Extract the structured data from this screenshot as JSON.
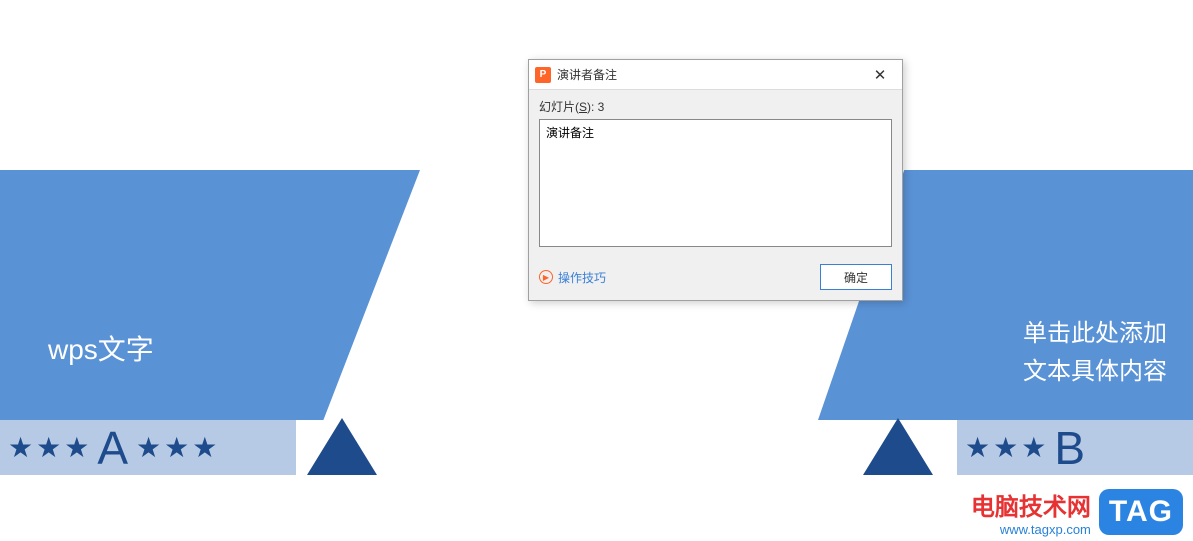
{
  "slide": {
    "left_title": "wps文字",
    "right_text_line1": "单击此处添加",
    "right_text_line2": "文本具体内容",
    "letter_a": "A",
    "letter_b": "B"
  },
  "dialog": {
    "title": "演讲者备注",
    "slide_label_prefix": "幻灯片(",
    "slide_label_key": "S",
    "slide_label_suffix": "): 3",
    "textarea_value": "演讲备注",
    "tips_label": "操作技巧",
    "ok_label": "确定"
  },
  "watermark": {
    "title": "电脑技术网",
    "url": "www.tagxp.com",
    "tag": "TAG"
  }
}
